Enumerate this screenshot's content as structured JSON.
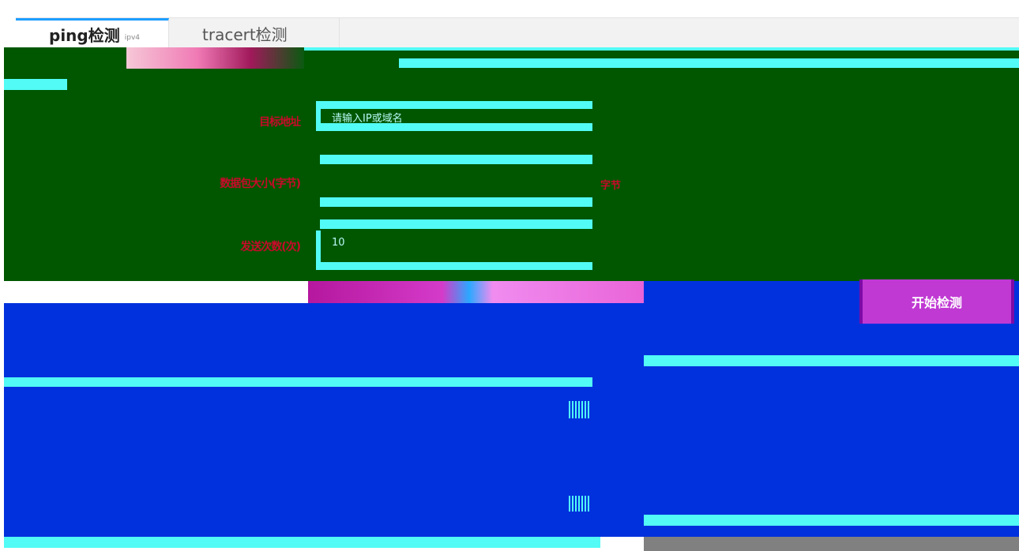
{
  "tabs": [
    {
      "label": "ping检测",
      "sub": "ipv4",
      "active": true
    },
    {
      "label": "tracert检测",
      "active": false
    }
  ],
  "form": {
    "target": {
      "label": "目标地址",
      "placeholder": "请输入IP或域名"
    },
    "packet_size": {
      "label": "数据包大小(字节)",
      "unit": "字节"
    },
    "count": {
      "label": "发送次数(次)",
      "value": "10"
    }
  },
  "detect_button": {
    "label": "开始检测"
  },
  "colors": {
    "tab_accent": "#1e9fff",
    "panel_green": "#005700",
    "panel_blue": "#0031dd",
    "cyan": "#52fbf5",
    "button": "#c039d3"
  }
}
